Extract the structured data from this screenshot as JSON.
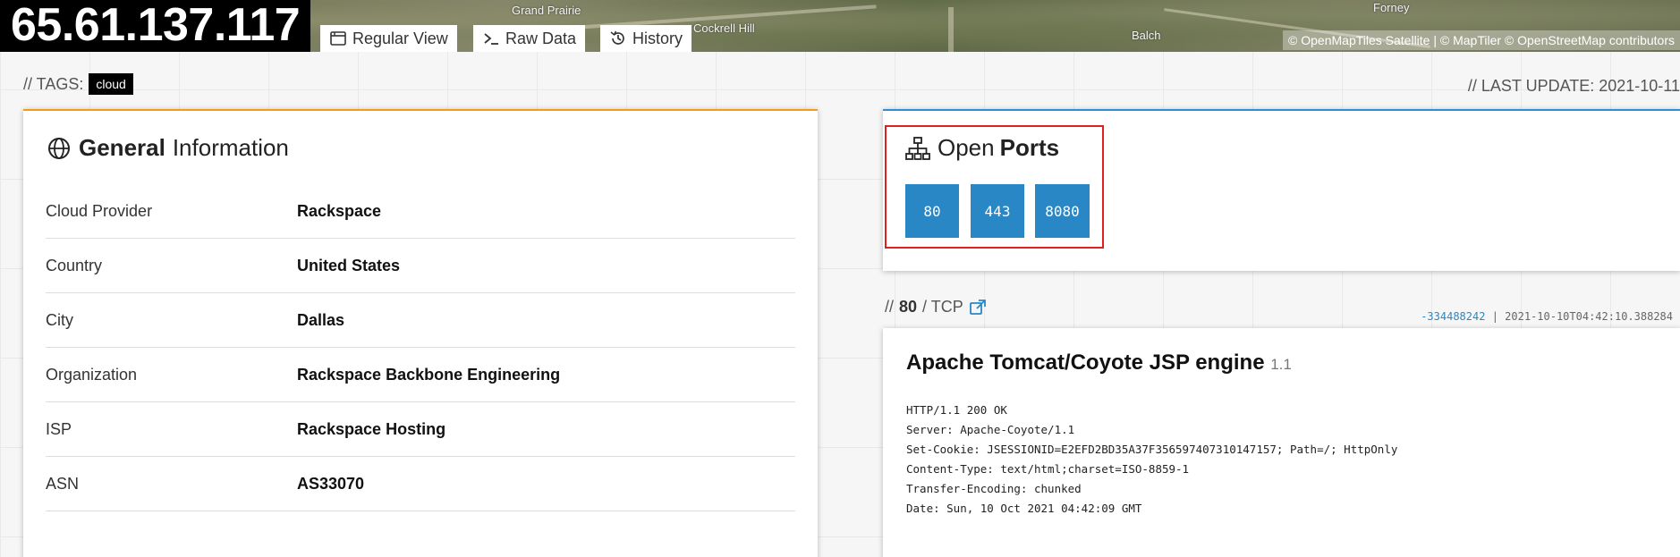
{
  "header": {
    "ip": "65.61.137.117",
    "map_labels": [
      "Grand Prairie",
      "Cockrell Hill",
      "Balch",
      "Forney"
    ],
    "attribution": "© OpenMapTiles Satellite | © MapTiler © OpenStreetMap contributors",
    "tabs": [
      {
        "label": "Regular View",
        "icon": "window-icon"
      },
      {
        "label": "Raw Data",
        "icon": "terminal-icon"
      },
      {
        "label": "History",
        "icon": "history-icon"
      }
    ]
  },
  "tags": {
    "label": "// TAGS:",
    "items": [
      "cloud"
    ]
  },
  "last_update": "// LAST UPDATE: 2021-10-11",
  "general": {
    "title_bold": "General",
    "title_light": "Information",
    "rows": [
      {
        "key": "Cloud Provider",
        "value": "Rackspace"
      },
      {
        "key": "Country",
        "value": "United States"
      },
      {
        "key": "City",
        "value": "Dallas"
      },
      {
        "key": "Organization",
        "value": "Rackspace Backbone Engineering"
      },
      {
        "key": "ISP",
        "value": "Rackspace Hosting"
      },
      {
        "key": "ASN",
        "value": "AS33070"
      }
    ]
  },
  "ports": {
    "title_light": "Open",
    "title_bold": "Ports",
    "items": [
      "80",
      "443",
      "8080"
    ]
  },
  "service": {
    "slash": "//",
    "port": "80",
    "proto": "/ TCP",
    "hash": "-334488242",
    "separator": "|",
    "timestamp": "2021-10-10T04:42:10.388284",
    "title": "Apache Tomcat/Coyote JSP engine",
    "version": "1.1",
    "banner": [
      "HTTP/1.1 200 OK",
      "Server: Apache-Coyote/1.1",
      "Set-Cookie: JSESSIONID=E2EFD2BD35A37F356597407310147157; Path=/; HttpOnly",
      "Content-Type: text/html;charset=ISO-8859-1",
      "Transfer-Encoding: chunked",
      "Date: Sun, 10 Oct 2021 04:42:09 GMT"
    ]
  },
  "colors": {
    "general_accent": "#f29b1d",
    "ports_accent": "#2f8fd1",
    "port_button": "#2a87c5",
    "highlight": "#e02020"
  }
}
